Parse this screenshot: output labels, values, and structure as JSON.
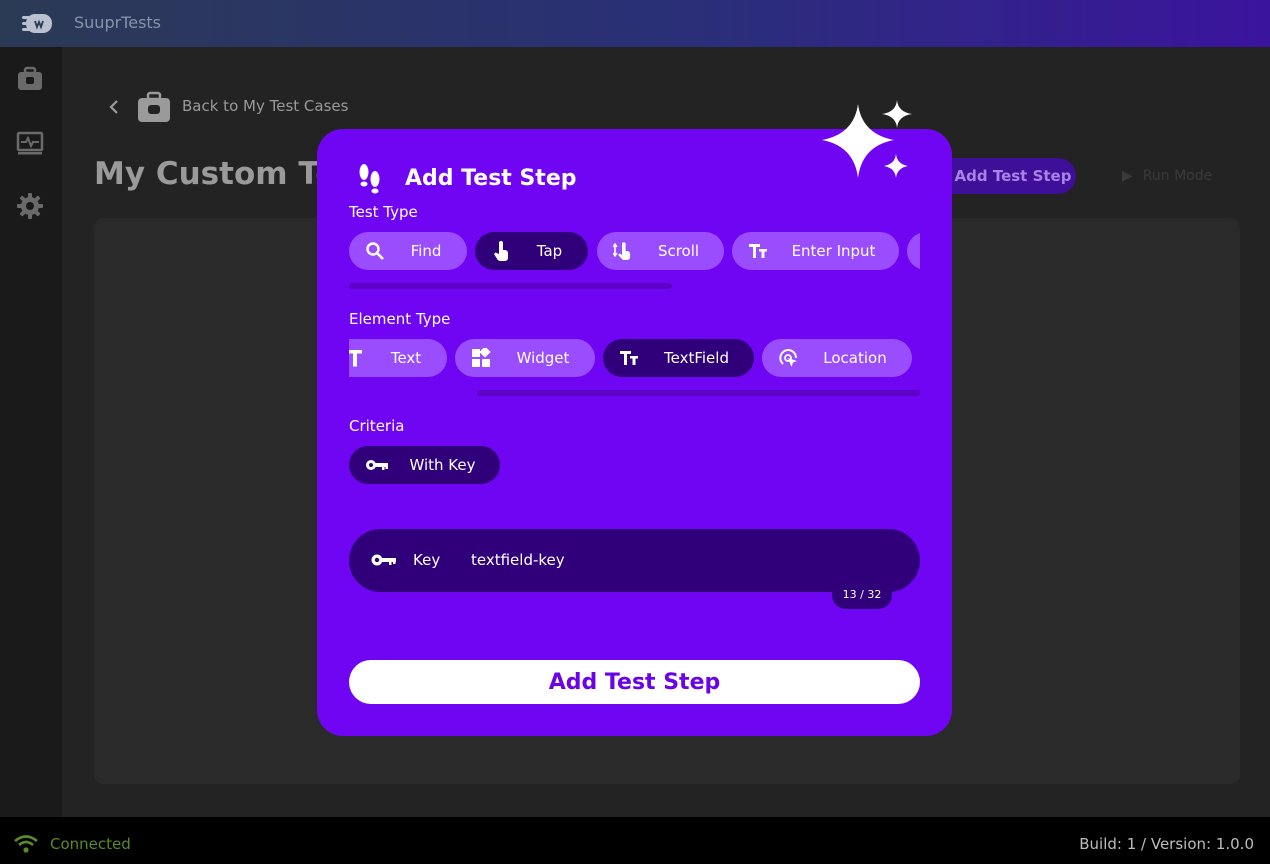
{
  "app": {
    "title": "SuuprTests"
  },
  "nav": {
    "back_label": "Back to My Test Cases",
    "page_title": "My Custom Test",
    "add_step_label": "Add Test Step",
    "run_label": "Run Mode"
  },
  "footer": {
    "connection": "Connected",
    "build": "Build: 1 / Version: 1.0.0"
  },
  "modal": {
    "title": "Add Test Step",
    "test_type": {
      "label": "Test Type",
      "options": [
        {
          "label": "Find",
          "icon": "search-icon"
        },
        {
          "label": "Tap",
          "icon": "tap-icon",
          "selected": true
        },
        {
          "label": "Scroll",
          "icon": "scroll-icon"
        },
        {
          "label": "Enter Input",
          "icon": "text-input-icon"
        }
      ]
    },
    "element_type": {
      "label": "Element Type",
      "options": [
        {
          "label": "Text",
          "icon": "text-icon"
        },
        {
          "label": "Widget",
          "icon": "widget-icon"
        },
        {
          "label": "TextField",
          "icon": "textfield-icon",
          "selected": true
        },
        {
          "label": "Location",
          "icon": "location-icon"
        }
      ]
    },
    "criteria": {
      "label": "Criteria",
      "options": [
        {
          "label": "With Key",
          "icon": "key-icon",
          "selected": true
        }
      ]
    },
    "key_field": {
      "label": "Key",
      "value": "textfield-key",
      "counter": "13 / 32"
    },
    "submit_label": "Add Test Step"
  },
  "colors": {
    "modal_bg": "#7005f3",
    "chip_bg": "#9a4dff",
    "chip_selected_bg": "#2f0079",
    "accent_text": "#6a04e6"
  }
}
